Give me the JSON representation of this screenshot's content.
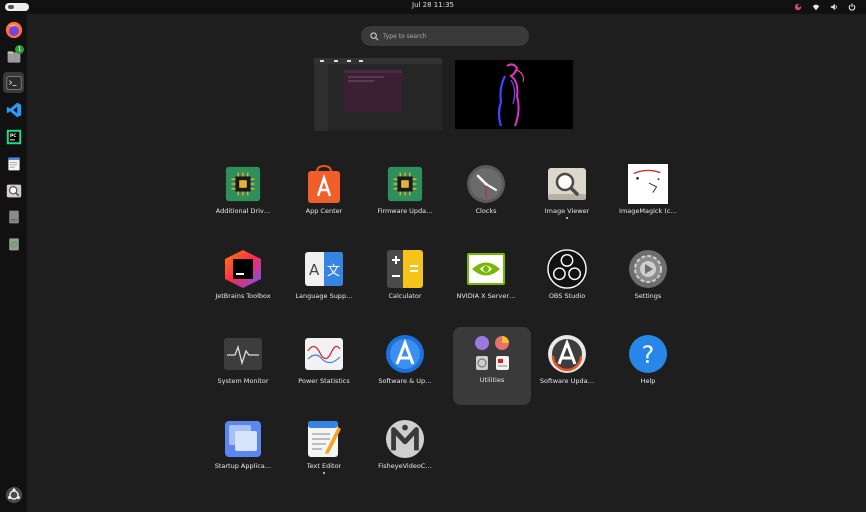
{
  "topbar": {
    "clock": "Jul 28  11:35"
  },
  "search": {
    "placeholder": "Type to search"
  },
  "dock": {
    "items": [
      {
        "name": "firefox-icon"
      },
      {
        "name": "files-icon",
        "badge": "1"
      },
      {
        "name": "terminal-icon",
        "active": true
      },
      {
        "name": "vscode-icon"
      },
      {
        "name": "pycharm-icon"
      },
      {
        "name": "text-editor-icon"
      },
      {
        "name": "image-viewer-icon"
      },
      {
        "name": "disk-icon"
      },
      {
        "name": "trash-icon"
      }
    ]
  },
  "apps": [
    {
      "label": "Additional Driv…",
      "icon": "chip-green-icon"
    },
    {
      "label": "App Center",
      "icon": "app-center-icon"
    },
    {
      "label": "Firmware Upda…",
      "icon": "chip-green-icon"
    },
    {
      "label": "Clocks",
      "icon": "clock-icon"
    },
    {
      "label": "Image Viewer",
      "icon": "magnifier-icon",
      "running": true
    },
    {
      "label": "ImageMagick (c…",
      "icon": "imagemagick-icon"
    },
    {
      "label": "JetBrains Toolbox",
      "icon": "jetbrains-icon"
    },
    {
      "label": "Language Supp…",
      "icon": "language-icon"
    },
    {
      "label": "Calculator",
      "icon": "calculator-icon"
    },
    {
      "label": "NVIDIA X Server…",
      "icon": "nvidia-icon"
    },
    {
      "label": "OBS Studio",
      "icon": "obs-icon"
    },
    {
      "label": "Settings",
      "icon": "settings-icon"
    },
    {
      "label": "System Monitor",
      "icon": "system-monitor-icon"
    },
    {
      "label": "Power Statistics",
      "icon": "power-statistics-icon"
    },
    {
      "label": "Software & Up…",
      "icon": "software-updates-icon"
    },
    {
      "label": "Utilities",
      "icon": "utilities-folder-icon",
      "focused": true
    },
    {
      "label": "Software Upda…",
      "icon": "software-updater-icon"
    },
    {
      "label": "Help",
      "icon": "help-icon"
    },
    {
      "label": "Startup Applica…",
      "icon": "startup-apps-icon"
    },
    {
      "label": "Text Editor",
      "icon": "text-editor-icon",
      "running": true
    },
    {
      "label": "FisheyeVideoC…",
      "icon": "fisheye-icon"
    }
  ]
}
